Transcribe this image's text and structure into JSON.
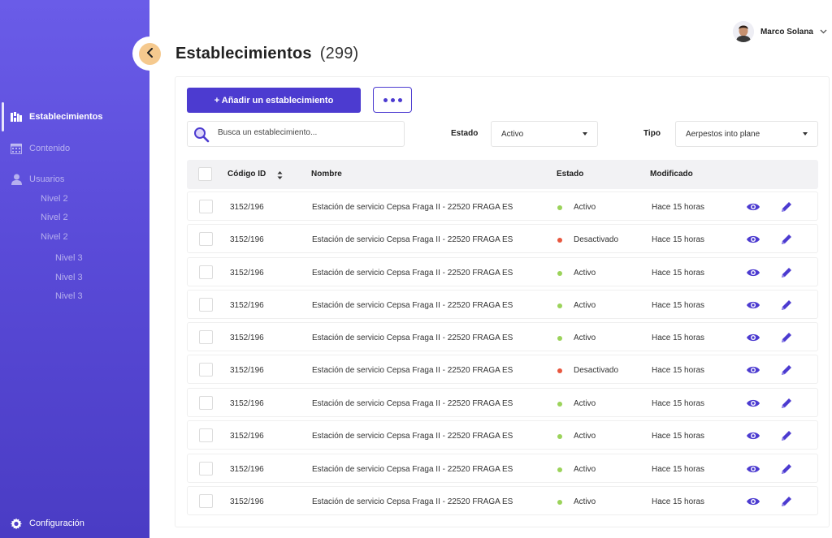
{
  "sidebar": {
    "nav": [
      {
        "label": "Establecimientos",
        "icon": "buildings-icon",
        "active": true
      },
      {
        "label": "Contenido",
        "icon": "calendar-grid-icon",
        "active": false
      },
      {
        "label": "Usuarios",
        "icon": "user-icon",
        "active": false
      }
    ],
    "sub_items": [
      "Nivel 2",
      "Nivel 2",
      "Nivel 2"
    ],
    "sub_sub_items": [
      "Nivel 3",
      "Nivel 3",
      "Nivel 3"
    ],
    "settings_label": "Configuración",
    "settings_icon": "gear-icon",
    "collapse_icon": "chevron-left-icon"
  },
  "header": {
    "title": "Establecimientos",
    "count": "(299)",
    "user_name": "Marco Solana",
    "user_menu_icon": "chevron-down-icon"
  },
  "toolbar": {
    "add_label": "+ Añadir un establecimiento",
    "more_icon": "more-dots-icon"
  },
  "filters": {
    "search_placeholder": "Busca un establecimiento...",
    "estado_label": "Estado",
    "estado_value": "Activo",
    "tipo_label": "Tipo",
    "tipo_value": "Aerpestos into plane"
  },
  "table": {
    "headers": {
      "id": "Código ID",
      "nombre": "Nombre",
      "estado": "Estado",
      "modificado": "Modificado"
    },
    "rows": [
      {
        "id": "3152/196",
        "nombre": "Estación de servicio Cepsa Fraga II - 22520 FRAGA ES",
        "estado": "Activo",
        "modificado": "Hace 15 horas"
      },
      {
        "id": "3152/196",
        "nombre": "Estación de servicio Cepsa Fraga II - 22520 FRAGA ES",
        "estado": "Desactivado",
        "modificado": "Hace 15 horas"
      },
      {
        "id": "3152/196",
        "nombre": "Estación de servicio Cepsa Fraga II - 22520 FRAGA ES",
        "estado": "Activo",
        "modificado": "Hace 15 horas"
      },
      {
        "id": "3152/196",
        "nombre": "Estación de servicio Cepsa Fraga II - 22520 FRAGA ES",
        "estado": "Activo",
        "modificado": "Hace 15 horas"
      },
      {
        "id": "3152/196",
        "nombre": "Estación de servicio Cepsa Fraga II - 22520 FRAGA ES",
        "estado": "Activo",
        "modificado": "Hace 15 horas"
      },
      {
        "id": "3152/196",
        "nombre": "Estación de servicio Cepsa Fraga II - 22520 FRAGA ES",
        "estado": "Desactivado",
        "modificado": "Hace 15 horas"
      },
      {
        "id": "3152/196",
        "nombre": "Estación de servicio Cepsa Fraga II - 22520 FRAGA ES",
        "estado": "Activo",
        "modificado": "Hace 15 horas"
      },
      {
        "id": "3152/196",
        "nombre": "Estación de servicio Cepsa Fraga II - 22520 FRAGA ES",
        "estado": "Activo",
        "modificado": "Hace 15 horas"
      },
      {
        "id": "3152/196",
        "nombre": "Estación de servicio Cepsa Fraga II - 22520 FRAGA ES",
        "estado": "Activo",
        "modificado": "Hace 15 horas"
      },
      {
        "id": "3152/196",
        "nombre": "Estación de servicio Cepsa Fraga II - 22520 FRAGA ES",
        "estado": "Activo",
        "modificado": "Hace 15 horas"
      }
    ],
    "row_actions": [
      "eye-icon",
      "pencil-icon"
    ]
  },
  "colors": {
    "accent": "#4c3bd0",
    "status_active": "#9bd35a",
    "status_inactive": "#e8573f",
    "collapse_button": "#f5c98e"
  }
}
